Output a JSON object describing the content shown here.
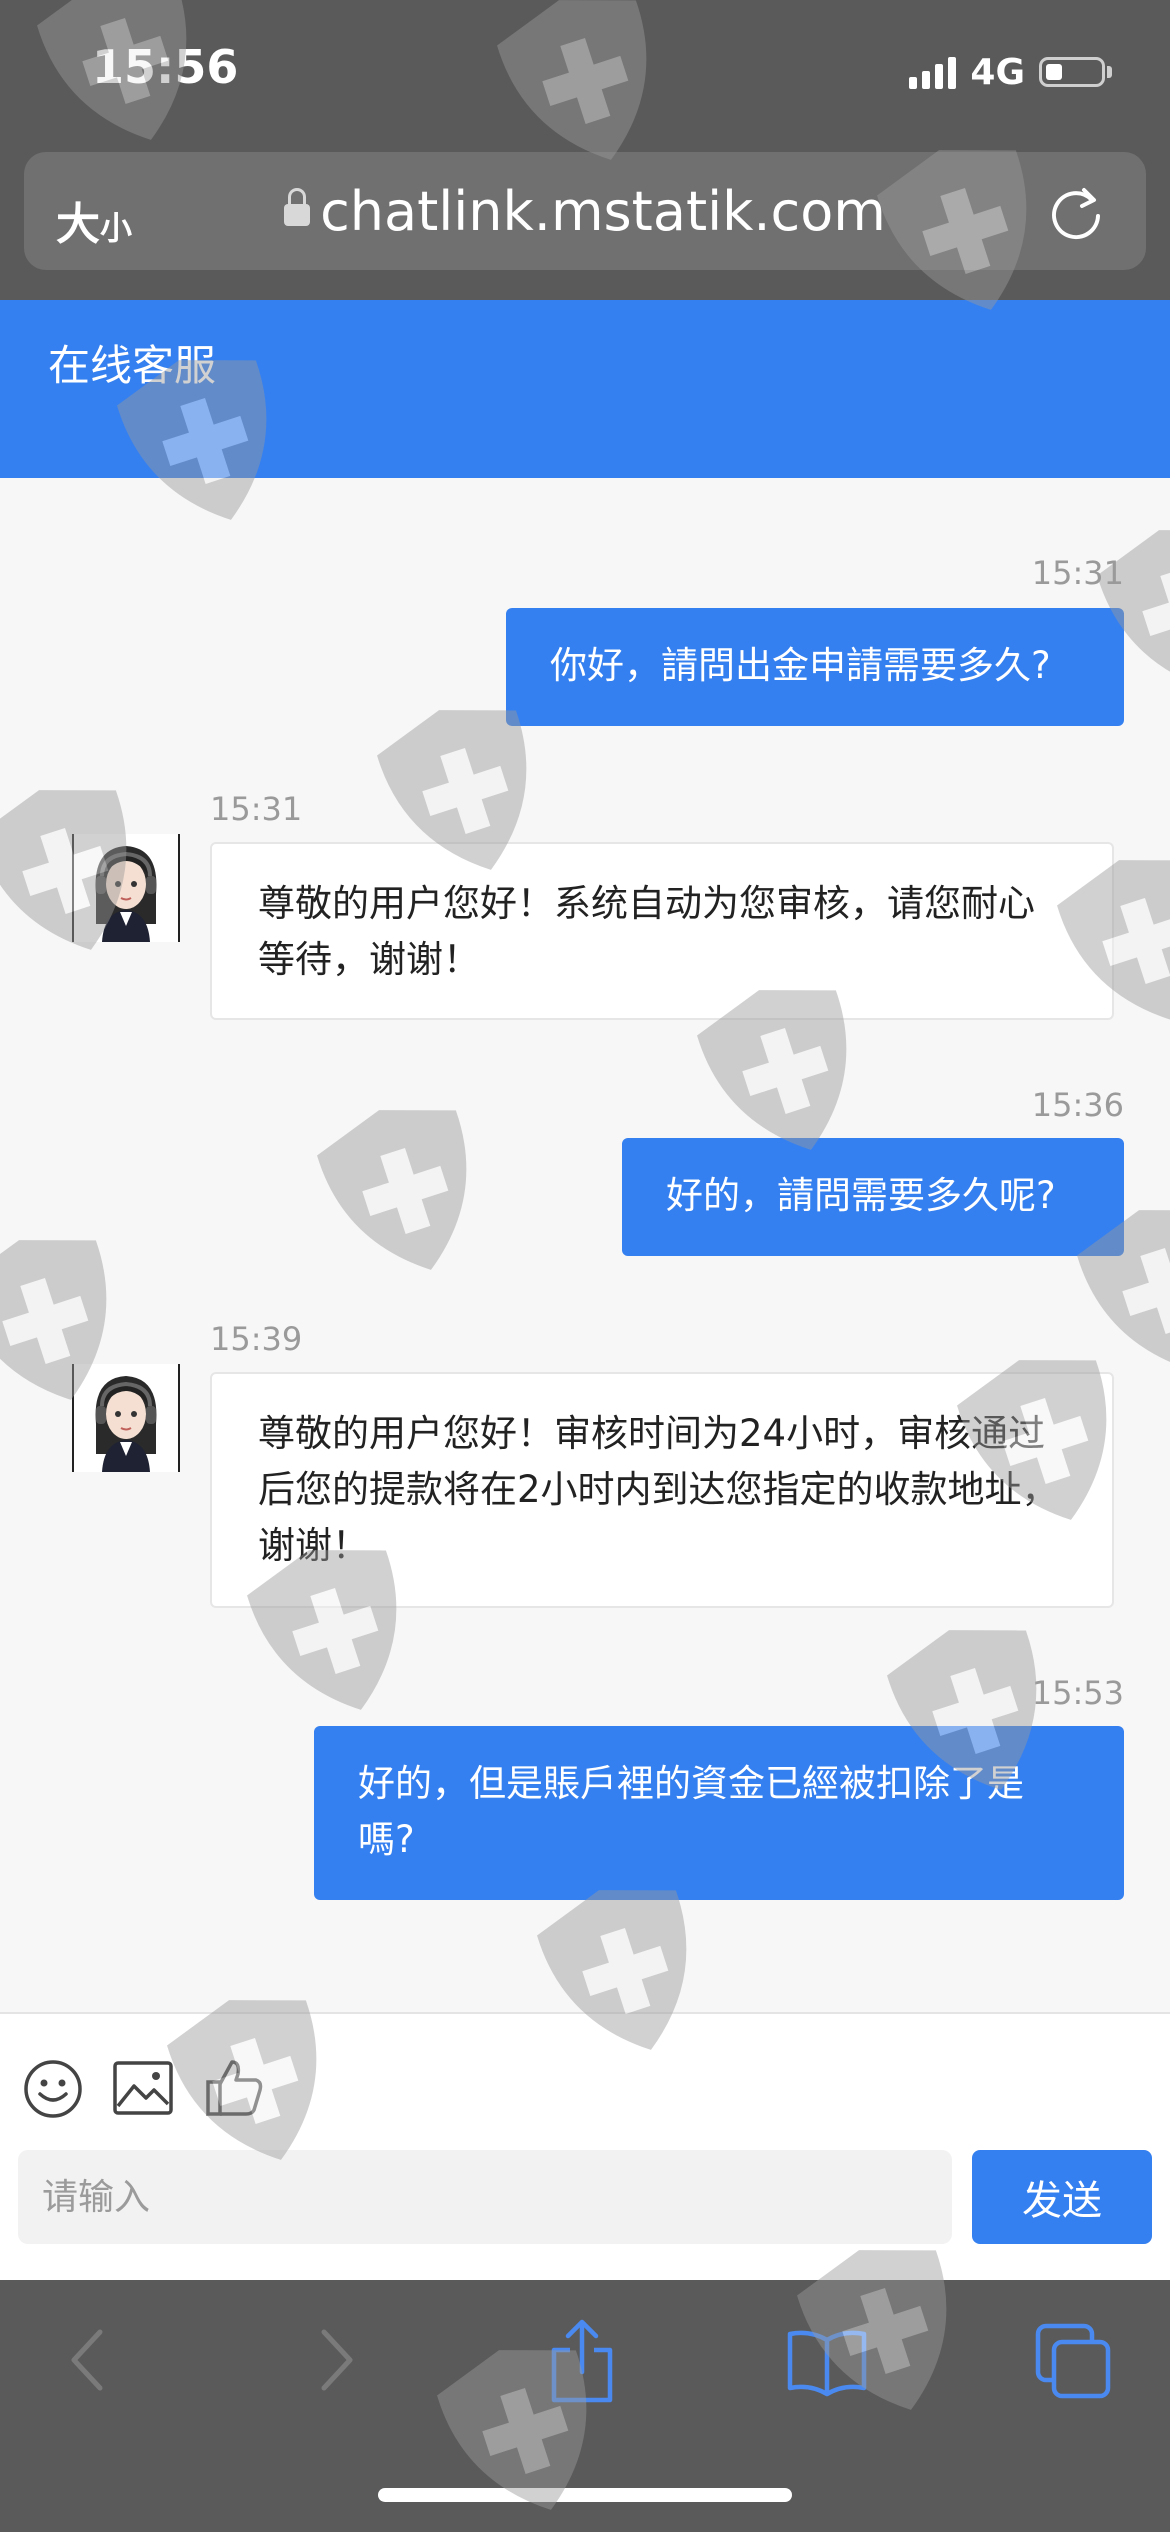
{
  "status_bar": {
    "time": "15:56",
    "network": "4G",
    "battery_level": 0.3
  },
  "browser": {
    "text_size_big": "大",
    "text_size_small": "小",
    "url": "chatlink.mstatik.com"
  },
  "header": {
    "title": "在线客服"
  },
  "messages": [
    {
      "side": "user",
      "time": "15:31",
      "text": "你好，請問出金申請需要多久?"
    },
    {
      "side": "agent",
      "time": "15:31",
      "text": "尊敬的用户您好！系统自动为您审核，请您耐心等待，谢谢！"
    },
    {
      "side": "user",
      "time": "15:36",
      "text": "好的，請問需要多久呢?"
    },
    {
      "side": "agent",
      "time": "15:39",
      "text": "尊敬的用户您好！审核时间为24小时，审核通过后您的提款将在2小时内到达您指定的收款地址，谢谢！"
    },
    {
      "side": "user",
      "time": "15:53",
      "text": "好的，但是賬戶裡的資金已經被扣除了是嗎?"
    }
  ],
  "composer": {
    "placeholder": "请输入",
    "send_label": "发送",
    "tools": [
      "emoji-icon",
      "image-icon",
      "thumbs-up-icon"
    ]
  },
  "toolbar": {
    "icons": [
      "back-icon",
      "forward-icon",
      "share-icon",
      "bookmarks-icon",
      "tabs-icon"
    ]
  },
  "colors": {
    "accent": "#3580f0",
    "chrome": "#5a5a5a",
    "toolbar_icon": "#4a8af0",
    "toolbar_icon_disabled": "#7a7a7a"
  }
}
